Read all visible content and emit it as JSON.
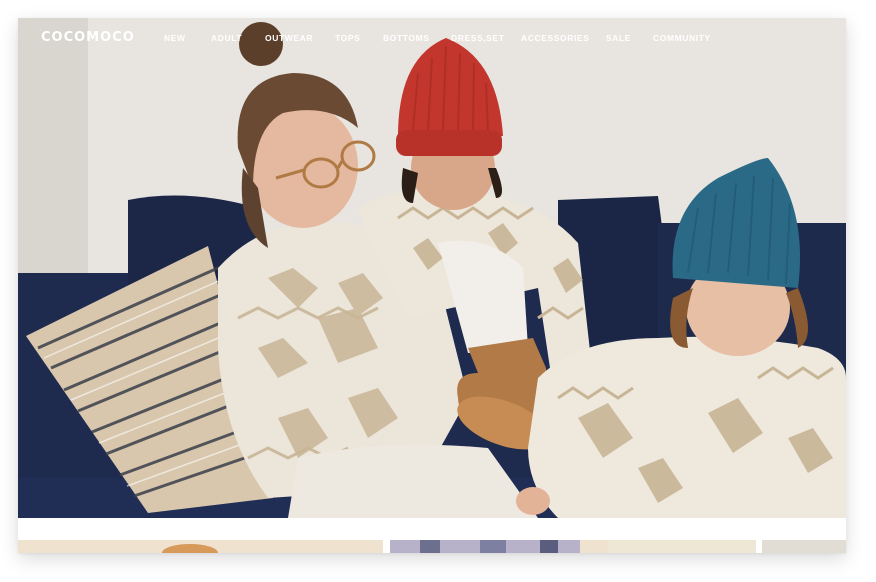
{
  "brand": {
    "logo": "COCOMOCO"
  },
  "nav": {
    "items": [
      {
        "label": "NEW"
      },
      {
        "label": "ADULT"
      },
      {
        "label": "OUTWEAR"
      },
      {
        "label": "TOPS"
      },
      {
        "label": "BOTTOMS"
      },
      {
        "label": "DRESS,SET"
      },
      {
        "label": "ACCESSORIES"
      },
      {
        "label": "SALE"
      },
      {
        "label": "COMMUNITY"
      }
    ]
  },
  "hero": {
    "scene": "mother-with-two-children-in-knit-sweaters",
    "colors": {
      "wall": "#e9e6e1",
      "sofa": "#1f2c4f",
      "sweater": "#eee8de",
      "pattern": "#c8b59a",
      "red_hat": "#c2362d",
      "blue_hat": "#2b6a86",
      "boot": "#b07a45"
    }
  },
  "thumbnails": [
    {
      "name": "thumb-1",
      "color": "#efe3cf"
    },
    {
      "name": "thumb-2",
      "color": "#c9c3d6"
    },
    {
      "name": "thumb-3",
      "color": "#efe7d6"
    },
    {
      "name": "thumb-4",
      "color": "#e2ddd4"
    }
  ]
}
